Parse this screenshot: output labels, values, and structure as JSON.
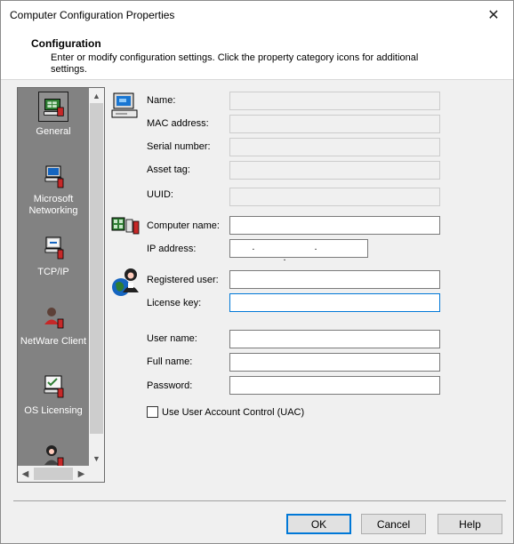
{
  "window": {
    "title": "Computer Configuration Properties"
  },
  "header": {
    "title": "Configuration",
    "description": "Enter or modify configuration settings. Click the property category icons for additional settings."
  },
  "nav": {
    "items": [
      {
        "label": "General",
        "icon": "general-computer-icon",
        "selected": true
      },
      {
        "label": "Microsoft Networking",
        "icon": "microsoft-networking-icon"
      },
      {
        "label": "TCP/IP",
        "icon": "tcpip-icon"
      },
      {
        "label": "NetWare Client",
        "icon": "netware-client-icon"
      },
      {
        "label": "OS Licensing",
        "icon": "os-licensing-icon"
      },
      {
        "label": "",
        "icon": "user-icon"
      }
    ]
  },
  "form": {
    "identity": {
      "name_label": "Name:",
      "mac_label": "MAC address:",
      "serial_label": "Serial number:",
      "asset_label": "Asset tag:",
      "uuid_label": "UUID:"
    },
    "network": {
      "computer_name_label": "Computer name:",
      "ip_label": "IP address:",
      "ip_value": ". . ."
    },
    "registration": {
      "registered_user_label": "Registered user:",
      "license_key_label": "License key:"
    },
    "account": {
      "user_name_label": "User name:",
      "full_name_label": "Full name:",
      "password_label": "Password:",
      "uac_label": "Use User Account Control (UAC)",
      "uac_checked": false
    }
  },
  "buttons": {
    "ok": "OK",
    "cancel": "Cancel",
    "help": "Help"
  },
  "colors": {
    "nav_background": "#828282",
    "focus_border": "#0078d7",
    "disabled_field": "#f0f0f0"
  }
}
